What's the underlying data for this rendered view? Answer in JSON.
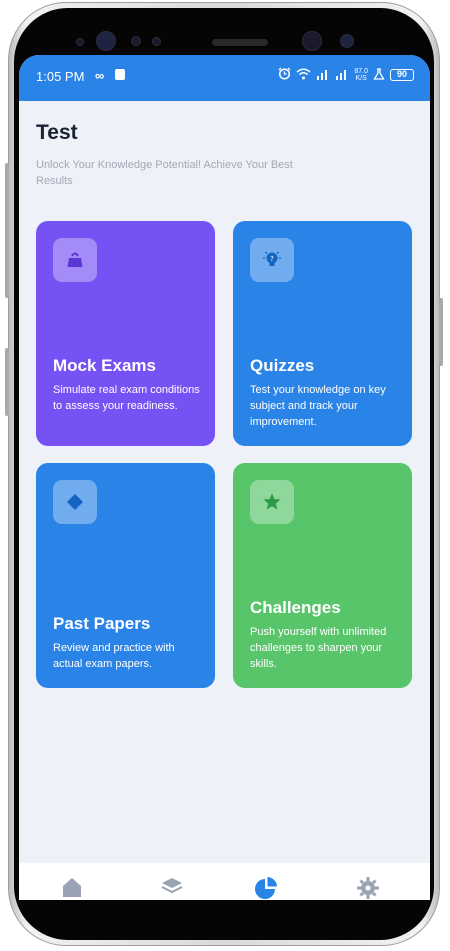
{
  "status_bar": {
    "time": "1:05 PM",
    "infinity": "∞",
    "net_speed_value": "87.0",
    "net_speed_unit": "K/S",
    "battery": "90"
  },
  "header": {
    "title": "Test",
    "subtitle": "Unlock Your Knowledge Potential! Achieve Your Best Results"
  },
  "cards": [
    {
      "title": "Mock Exams",
      "description": "Simulate real exam conditions to assess your readiness.",
      "color": "#7652f5",
      "icon": "exam-bag-icon"
    },
    {
      "title": "Quizzes",
      "description": "Test your knowledge on key subject and track your improvement.",
      "color": "#2a83e6",
      "icon": "lightbulb-icon"
    },
    {
      "title": "Past Papers",
      "description": "Review and practice with actual exam papers.",
      "color": "#2a83e6",
      "icon": "diamond-icon"
    },
    {
      "title": "Challenges",
      "description": "Push yourself with unlimited challenges to sharpen your skills.",
      "color": "#58c56a",
      "icon": "star-badge-icon"
    }
  ],
  "bottom_nav": [
    {
      "icon": "home-icon",
      "active": false
    },
    {
      "icon": "layers-icon",
      "active": false
    },
    {
      "icon": "pie-chart-icon",
      "active": true
    },
    {
      "icon": "settings-icon",
      "active": false
    }
  ],
  "colors": {
    "primary": "#2a83e6",
    "purple": "#7652f5",
    "green": "#58c56a",
    "background": "#eef1f8",
    "nav_inactive": "#9aa3b3"
  }
}
